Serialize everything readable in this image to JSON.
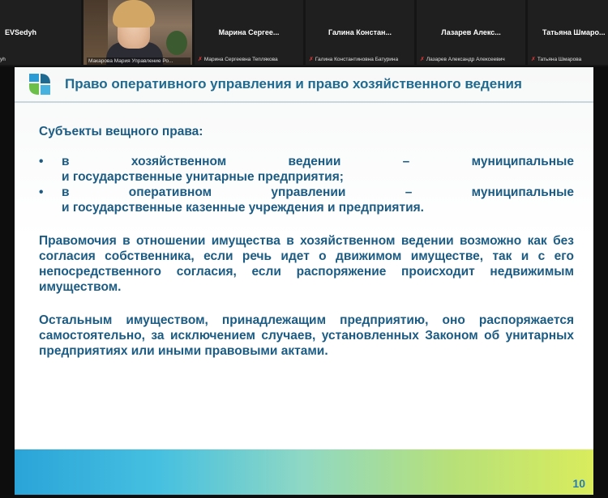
{
  "participants": [
    {
      "title": "EVSedyh",
      "caption": "yh"
    },
    {
      "title": "",
      "caption": "Макарова Мария Управление Ро..."
    },
    {
      "title": "Марина Сергее...",
      "caption": "Марина Сергеевна Теплякова"
    },
    {
      "title": "Галина Констан...",
      "caption": "Галина Константиновна Батурина"
    },
    {
      "title": "Лазарев Алекс...",
      "caption": "Лазарев Александр Алексеевич"
    },
    {
      "title": "Татьяна Шмаро...",
      "caption": "Татьяна Шмарова"
    }
  ],
  "slide": {
    "title": "Право оперативного управления и право хозяйственного ведения",
    "subjects_heading": "Субъекты вещного права:",
    "bullets": [
      {
        "line1": "в хозяйственном ведении – муниципальные",
        "line2": "и государственные унитарные предприятия;"
      },
      {
        "line1": "в оперативном управлении – муниципальные",
        "line2": "и государственные казенные учреждения и предприятия."
      }
    ],
    "paragraph2": "Правомочия в отношении имущества в хозяйственном ведении возможно как без согласия собственника, если речь идет о движимом имуществе, так и с его непосредственного согласия, если распоряжение происходит недвижимым имуществом.",
    "paragraph3": "Остальным имуществом, принадлежащим предприятию, оно распоряжается самостоятельно, за исключением случаев, установленных Законом об унитарных предприятиях или иными правовыми актами.",
    "page_number": "10"
  },
  "colors": {
    "accent": "#1c5c84",
    "title": "#1f6a91"
  }
}
